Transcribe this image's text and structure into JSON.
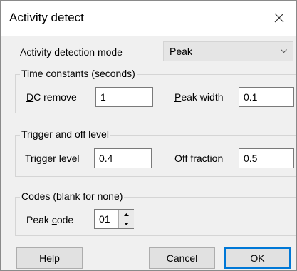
{
  "dialog": {
    "title": "Activity detect"
  },
  "mode": {
    "label": "Activity detection mode",
    "value": "Peak"
  },
  "time_constants": {
    "title": "Time constants (seconds)",
    "dc_remove_key": "D",
    "dc_remove_rest": "C remove",
    "dc_remove_value": "1",
    "peak_width_key": "P",
    "peak_width_rest": "eak width",
    "peak_width_value": "0.1"
  },
  "trigger": {
    "title": "Trigger and off level",
    "trigger_key": "T",
    "trigger_rest": "rigger level",
    "trigger_value": "0.4",
    "off_pre": "Off ",
    "off_key": "f",
    "off_rest": "raction",
    "off_value": "0.5"
  },
  "codes": {
    "title": "Codes (blank for none)",
    "peak_pre": "Peak ",
    "peak_key": "c",
    "peak_rest": "ode",
    "peak_value": "01"
  },
  "buttons": {
    "help": "Help",
    "cancel": "Cancel",
    "ok": "OK"
  }
}
